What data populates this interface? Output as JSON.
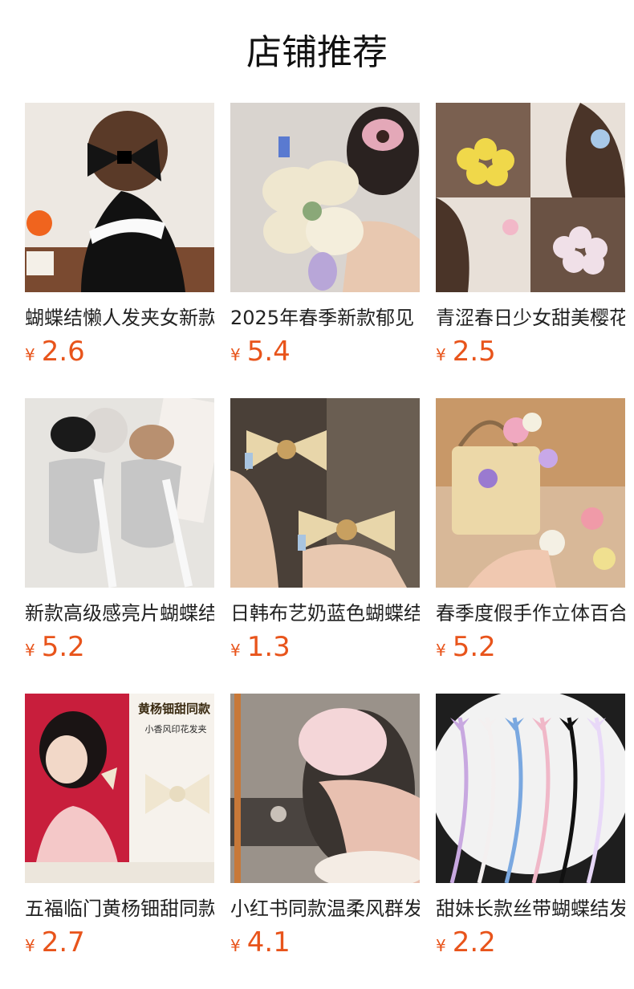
{
  "section": {
    "title": "店铺推荐"
  },
  "products": [
    {
      "title": "蝴蝶结懒人发夹女新款",
      "currency": "¥",
      "price": "2.6",
      "image_icon": "black-bow-hair-clip-photo",
      "palette": {
        "bg": "#ede8e2",
        "main": "#141414",
        "accent": "#5a3a28",
        "extra": "#f0641e"
      }
    },
    {
      "title": "2025年春季新款郁见",
      "currency": "¥",
      "price": "5.4",
      "image_icon": "satin-flower-hair-clip-photo",
      "palette": {
        "bg": "#d9d4cf",
        "main": "#efe7cf",
        "accent": "#e4a8b8",
        "extra": "#b8a6d8"
      }
    },
    {
      "title": "青涩春日少女甜美樱花",
      "currency": "¥",
      "price": "2.5",
      "image_icon": "knitted-flower-clip-photo",
      "palette": {
        "bg": "#6d5648",
        "main": "#f0d84a",
        "accent": "#f2b8c8",
        "extra": "#a8c8e8"
      }
    },
    {
      "title": "新款高级感亮片蝴蝶结",
      "currency": "¥",
      "price": "5.2",
      "image_icon": "sequin-bow-scrunchie-photo",
      "palette": {
        "bg": "#e6e4e0",
        "main": "#c6c6c6",
        "accent": "#1a1a1a",
        "extra": "#b89070"
      }
    },
    {
      "title": "日韩布艺奶蓝色蝴蝶结",
      "currency": "¥",
      "price": "1.3",
      "image_icon": "lace-star-bow-clip-photo",
      "palette": {
        "bg": "#4a4038",
        "main": "#e8d6aa",
        "accent": "#a8c4e0",
        "extra": "#c8a060"
      }
    },
    {
      "title": "春季度假手作立体百合",
      "currency": "¥",
      "price": "5.2",
      "image_icon": "handmade-flower-clip-basket-photo",
      "palette": {
        "bg": "#b88a60",
        "main": "#ecd8a8",
        "accent": "#f0a8c0",
        "extra": "#c8a8e8"
      }
    },
    {
      "title": "五福临门黄杨钿甜同款",
      "currency": "¥",
      "price": "2.7",
      "image_icon": "celebrity-bow-clip-ad-photo",
      "palette": {
        "bg": "#f6f2ec",
        "main": "#c81e3c",
        "accent": "#f0e6d0",
        "extra": "#8a5a14"
      },
      "overlay": {
        "headline": "黄杨钿甜同款",
        "subline": "小香风印花发夹"
      }
    },
    {
      "title": "小红书同款温柔风群发",
      "currency": "¥",
      "price": "4.1",
      "image_icon": "lace-scrunchie-cafe-photo",
      "palette": {
        "bg": "#8a8078",
        "main": "#f4d6d8",
        "accent": "#d8b0a0",
        "extra": "#3a3430"
      }
    },
    {
      "title": "甜妹长款丝带蝴蝶结发夹",
      "currency": "¥",
      "price": "2.2",
      "image_icon": "long-ribbon-bow-clips-photo",
      "palette": {
        "bg": "#1e1e1e",
        "main": "#f2f2f2",
        "accent": "#c8a8e0",
        "extra": "#7aa8e0"
      }
    }
  ]
}
